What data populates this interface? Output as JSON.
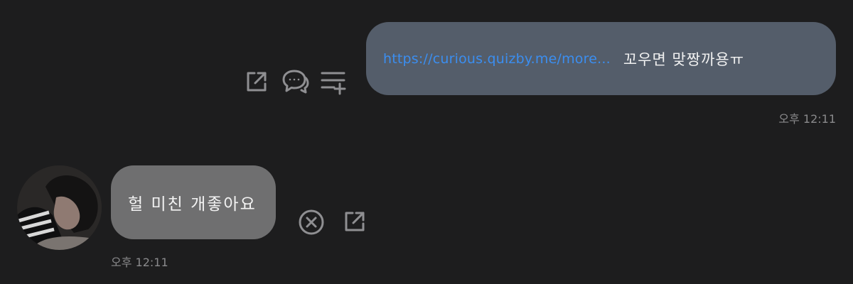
{
  "messages": {
    "outgoing": {
      "link_text": "https://curious.quizby.me/more...",
      "text": "꼬우면 맞짱까용ㅠ",
      "time": "오후 12:11"
    },
    "incoming": {
      "text": "헐 미친 개좋아요",
      "time": "오후 12:11"
    }
  },
  "icons": {
    "outgoing_actions": [
      "share-icon",
      "comment-icon",
      "add-to-playlist-icon"
    ],
    "incoming_actions": [
      "close-circle-icon",
      "share-icon"
    ]
  },
  "colors": {
    "background": "#1d1d1e",
    "outgoing_bubble": "#545d6a",
    "incoming_bubble": "#6f6f70",
    "link": "#3b8ef0",
    "icon": "#8f8f92",
    "timestamp": "#8a8a8c"
  }
}
